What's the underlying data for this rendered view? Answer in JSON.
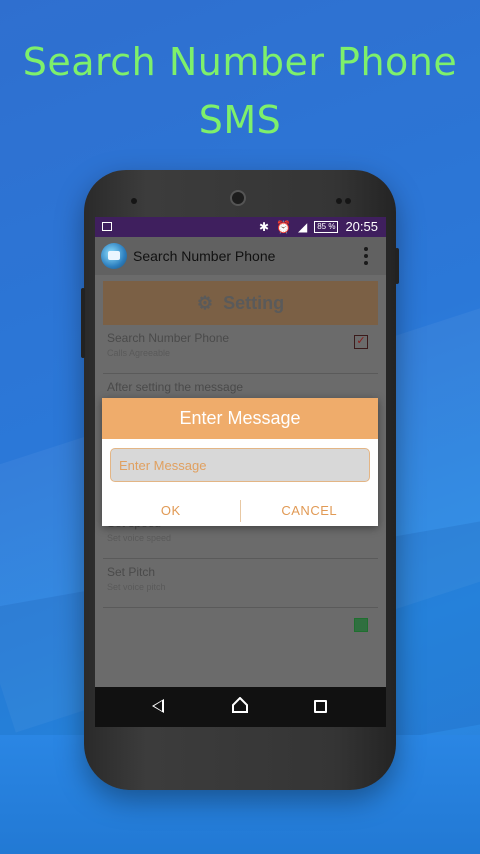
{
  "promo": {
    "headline_line1": "Search Number Phone",
    "headline_line2": "SMS"
  },
  "status_bar": {
    "icons": [
      "image-icon",
      "bluetooth-icon",
      "alarm-icon",
      "signal-icon"
    ],
    "battery": "85 %",
    "time": "20:55"
  },
  "app_bar": {
    "title": "Search Number Phone",
    "logo_icon": "app-logo-icon",
    "menu_icon": "overflow-menu-icon"
  },
  "settings": {
    "header": "Setting",
    "header_icon": "gear-icon",
    "items": [
      {
        "title": "Search Number Phone",
        "summary": "Calls Agreeable",
        "checked": true
      },
      {
        "title": "After setting the message",
        "summary": ""
      },
      {
        "title": "Set speed",
        "summary": "Set voice speed"
      },
      {
        "title": "Set Pitch",
        "summary": "Set voice pitch"
      }
    ]
  },
  "dialog": {
    "title": "Enter Message",
    "input_placeholder": "Enter Message",
    "input_value": "",
    "ok_label": "OK",
    "cancel_label": "CANCEL"
  },
  "navbar": {
    "icons": [
      "back-icon",
      "home-icon",
      "recents-icon"
    ]
  },
  "colors": {
    "headline": "#7ef06b",
    "status_bar": "#3f1f5e",
    "dialog_accent": "#efac6b",
    "dialog_button_text": "#e19a55"
  }
}
